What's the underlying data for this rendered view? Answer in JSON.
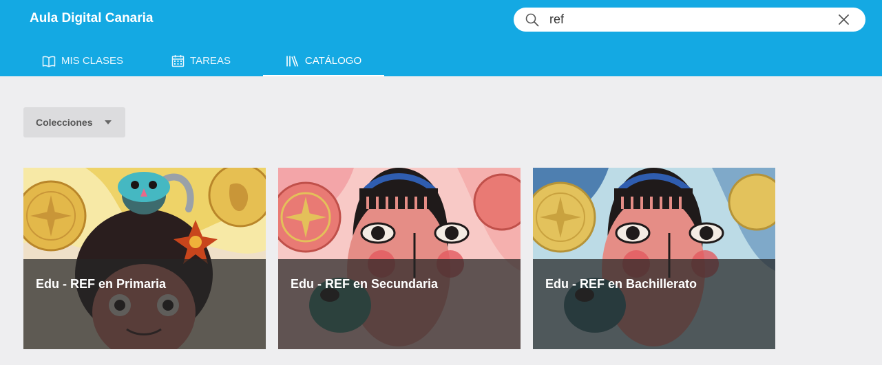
{
  "app": {
    "title": "Aula Digital Canaria"
  },
  "search": {
    "value": "ref",
    "icon": "search-icon",
    "clear_icon": "close-icon"
  },
  "tabs": [
    {
      "label": "MIS CLASES",
      "icon": "book-open-icon",
      "active": false
    },
    {
      "label": "TAREAS",
      "icon": "calendar-icon",
      "active": false
    },
    {
      "label": "CATÁLOGO",
      "icon": "library-icon",
      "active": true
    }
  ],
  "filter": {
    "label": "Colecciones",
    "icon": "caret-down-icon"
  },
  "cards": [
    {
      "title": "Edu - REF en Primaria",
      "theme": "yellow"
    },
    {
      "title": "Edu - REF en Secundaria",
      "theme": "pink"
    },
    {
      "title": "Edu - REF en Bachillerato",
      "theme": "blue"
    }
  ],
  "colors": {
    "header": "#14a9e3",
    "background": "#eeeef0",
    "filter_button": "#dcdcde",
    "overlay": "rgba(38,38,38,0.72)"
  }
}
